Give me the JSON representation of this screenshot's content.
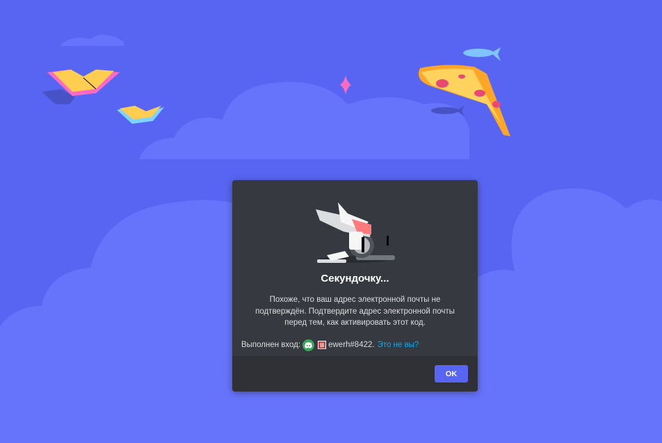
{
  "modal": {
    "title": "Секундочку...",
    "description": "Похоже, что ваш адрес электронной почты не подтверждён. Подтвердите адрес электронной почты перед тем, как активировать этот код.",
    "login_prefix": "Выполнен вход:",
    "badge_letter": "В",
    "username": "ewerh#8422.",
    "not_you_link": "Это не вы?",
    "ok_label": "OK"
  },
  "icons": {
    "illustration": "blender-robot-illustration",
    "avatar": "discord-logo-icon",
    "badge": "user-badge-icon"
  },
  "colors": {
    "background": "#5865f2",
    "cloud": "#6673fb",
    "modal": "#36393f",
    "footer": "#2f3136",
    "accent": "#5865f2",
    "link": "#00aff4",
    "avatar": "#3ba55c"
  }
}
